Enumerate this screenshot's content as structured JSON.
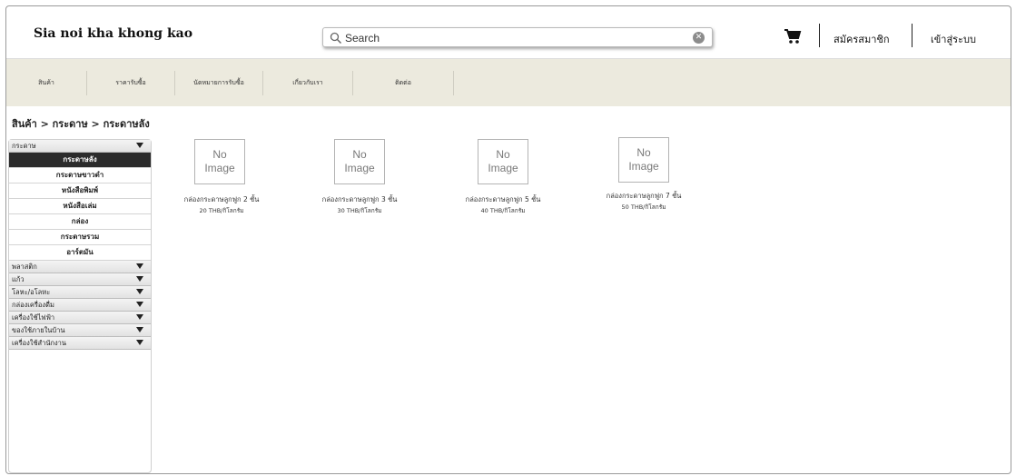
{
  "header": {
    "brand": "Sia noi kha khong kao",
    "search_placeholder": "Search",
    "register": "สมัครสมาชิก",
    "login": "เข้าสู่ระบบ"
  },
  "nav": [
    "สินค้า",
    "ราคารับซื้อ",
    "นัดหมายการรับซื้อ",
    "เกี่ยวกับเรา",
    "ติดต่อ"
  ],
  "breadcrumb": "สินค้า > กระดาษ > กระดาษลัง",
  "sidebar": {
    "open_category": "กระดาษ",
    "subitems": [
      "กระดาษลัง",
      "กระดาษขาวดำ",
      "หนังสือพิมพ์",
      "หนังสือเล่ม",
      "กล่อง",
      "กระดาษรวม",
      "อาร์ตมัน"
    ],
    "active_subitem": "กระดาษลัง",
    "categories": [
      "พลาสติก",
      "แก้ว",
      "โลหะ/อโลหะ",
      "กล่องเครื่องดื่ม",
      "เครื่องใช้ไฟฟ้า",
      "ของใช้ภายในบ้าน",
      "เครื่องใช้สำนักงาน"
    ]
  },
  "placeholder_image": {
    "line1": "No",
    "line2": "Image"
  },
  "products": [
    {
      "name": "กล่องกระดาษลูกฟูก 2 ชั้น",
      "price": "20 THB/กิโลกรัม"
    },
    {
      "name": "กล่องกระดาษลูกฟูก 3 ชั้น",
      "price": "30 THB/กิโลกรัม"
    },
    {
      "name": "กล่องกระดาษลูกฟูก 5 ชั้น",
      "price": "40 THB/กิโลกรัม"
    },
    {
      "name": "กล่องกระดาษลูกฟูก 7 ชั้น",
      "price": "50 THB/กิโลกรัม"
    }
  ],
  "icons": {
    "search": "search-icon",
    "clear": "clear-search-icon",
    "cart": "cart-icon",
    "dropdown": "chevron-down-icon"
  },
  "colors": {
    "navbar_bg": "#eceade",
    "active_item_bg": "#2b2b2b"
  }
}
